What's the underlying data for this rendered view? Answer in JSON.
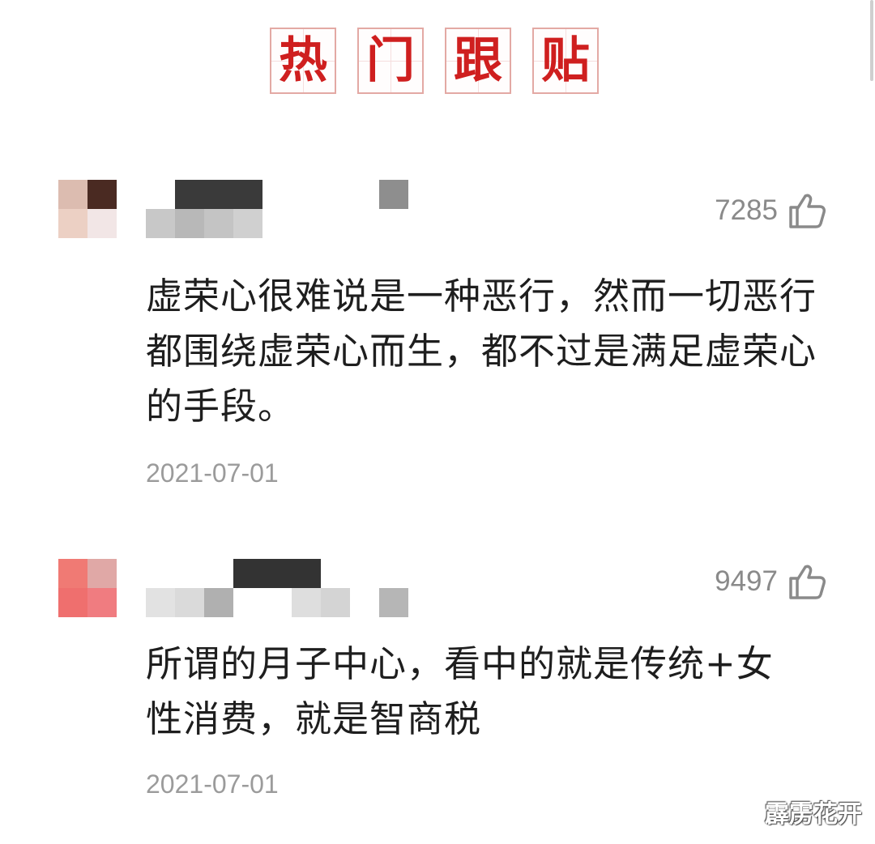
{
  "header": {
    "title_chars": [
      "热",
      "门",
      "跟",
      "贴"
    ]
  },
  "comments": [
    {
      "like_count": "7285",
      "text": "虚荣心很难说是一种恶行，然而一切恶行都围绕虚荣心而生，都不过是满足虚荣心的手段。",
      "date": "2021-07-01"
    },
    {
      "like_count": "9497",
      "text": "所谓的月子中心，看中的就是传统+女性消费，就是智商税",
      "date": "2021-07-01"
    }
  ],
  "watermark": {
    "text": "霹雳花开"
  },
  "colors": {
    "banner_red": "#cf1f1f",
    "banner_border": "#e3a9a4",
    "meta_gray": "#9b9b9b"
  },
  "icons": {
    "like": "thumb-up-icon"
  }
}
